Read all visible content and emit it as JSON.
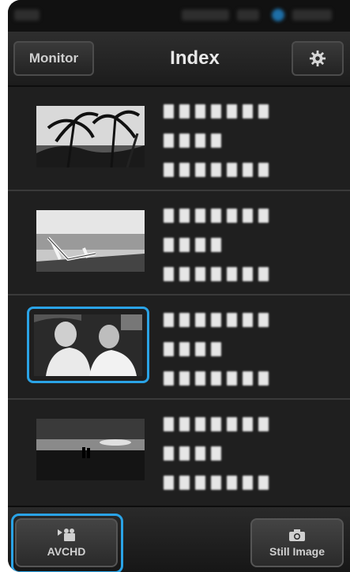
{
  "header": {
    "monitor_label": "Monitor",
    "title": "Index",
    "settings_icon": "gear-icon"
  },
  "list": {
    "items": [
      {
        "thumbnail": "palm trees",
        "lines": [
          "▮▮▮▮▮▮▮",
          "▮▮▮▮",
          "▮▮▮▮▮▮▮"
        ],
        "selected": false
      },
      {
        "thumbnail": "beach chair",
        "lines": [
          "▮▮▮▮▮▮▮",
          "▮▮▮▮",
          "▮▮▮▮▮▮▮"
        ],
        "selected": false
      },
      {
        "thumbnail": "people",
        "lines": [
          "▮▮▮▮▮▮▮",
          "▮▮▮▮",
          "▮▮▮▮▮▮▮"
        ],
        "selected": true
      },
      {
        "thumbnail": "sunset couple",
        "lines": [
          "▮▮▮▮▮▮▮",
          "▮▮▮▮",
          "▮▮▮▮▮▮▮"
        ],
        "selected": false
      }
    ]
  },
  "footer": {
    "avchd_label": "AVCHD",
    "still_label": "Still Image",
    "avchd_icon": "video-camera-icon",
    "still_icon": "camera-icon"
  },
  "colors": {
    "accent": "#2aa3e6",
    "background": "#1f1f1f"
  }
}
